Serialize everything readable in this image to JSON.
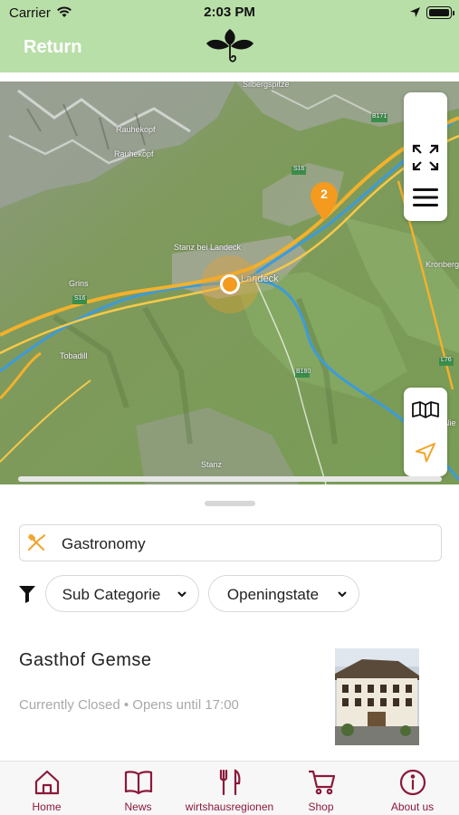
{
  "status_bar": {
    "carrier": "Carrier",
    "time": "2:03 PM",
    "wifi_icon": "wifi-icon",
    "location_icon": "location-arrow-icon",
    "battery_icon": "battery-icon"
  },
  "nav": {
    "return_label": "Return",
    "logo_icon": "leaf-logo-icon",
    "background_color": "#b9dfa8"
  },
  "map": {
    "labels": [
      "Silbergspitze",
      "Rauhekopf",
      "Rauhekopf",
      "Stanz bei Landeck",
      "Landeck",
      "Grins",
      "Tobadill",
      "Kronberg",
      "Nie",
      "Stanz",
      "S16",
      "S16",
      "B171",
      "B180",
      "L76"
    ],
    "cluster_count": "2",
    "controls": {
      "fullscreen_icon": "fullscreen-icon",
      "layers_icon": "menu-icon",
      "map_style_icon": "map-book-icon",
      "locate_icon": "navigation-arrow-icon"
    },
    "accent_color": "#f39a1f"
  },
  "sheet": {
    "category_label": "Gastronomy",
    "category_icon": "fork-knife-icon",
    "filter_icon": "filter-icon",
    "sub_category_label": "Sub Categorie",
    "opening_state_label": "Openingstate",
    "result": {
      "title": "Gasthof Gemse",
      "status": "Currently Closed • Opens until 17:00"
    }
  },
  "tabs": [
    {
      "label": "Home",
      "icon": "home-icon"
    },
    {
      "label": "News",
      "icon": "book-open-icon"
    },
    {
      "label": "wirtshausregionen",
      "icon": "fork-knife-icon"
    },
    {
      "label": "Shop",
      "icon": "cart-icon"
    },
    {
      "label": "About us",
      "icon": "info-icon"
    }
  ],
  "tab_color": "#8b1a3a"
}
